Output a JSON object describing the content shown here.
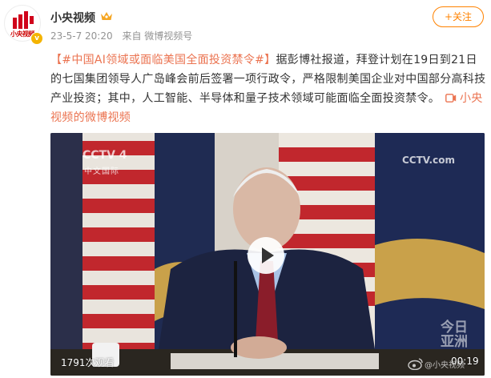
{
  "account": {
    "name": "小央视频",
    "avatar_text": "小央视频",
    "verified_icon": "verified-badge-icon",
    "crown_icon": "crown-icon"
  },
  "meta": {
    "date": "23-5-7 20:20",
    "source": "来自 微博视频号"
  },
  "follow_label": "+关注",
  "post": {
    "hashtag": "【#中国AI领域或面临美国全面投资禁令#】",
    "body": "据彭博社报道，拜登计划在19日到21日的七国集团领导人广岛峰会前后签署一项行政令，严格限制美国企业对中国部分高科技产业投资；其中，人工智能、半导体和量子技术领域可能面临全面投资禁令。",
    "source_link_icon": "video-link-icon",
    "source_link_label": "小央视频的微博视频"
  },
  "video": {
    "view_count": "1791次观看",
    "duration": "00:19",
    "watermark_left": "CCTV 4",
    "watermark_left_sub": "中文国际",
    "watermark_right": "CCTV.com",
    "watermark_jinri": "今日亚洲",
    "watermark_weibo": "@小央视频"
  },
  "colors": {
    "accent": "#ff8200",
    "link": "#eb7350",
    "meta": "#939393"
  }
}
